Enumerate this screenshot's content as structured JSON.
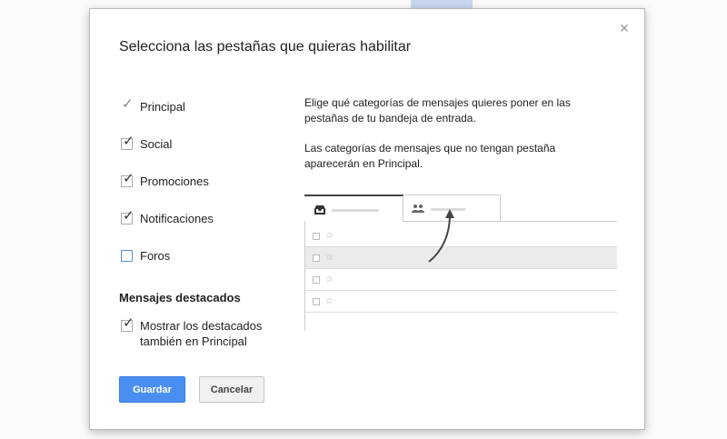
{
  "dialog": {
    "title": "Selecciona las pestañas que quieras habilitar",
    "close_icon": "close-icon"
  },
  "categories": [
    {
      "label": "Principal",
      "checked": true,
      "locked": true
    },
    {
      "label": "Social",
      "checked": true,
      "locked": false
    },
    {
      "label": "Promociones",
      "checked": true,
      "locked": false
    },
    {
      "label": "Notificaciones",
      "checked": true,
      "locked": false
    },
    {
      "label": "Foros",
      "checked": false,
      "locked": false
    }
  ],
  "starred": {
    "section_title": "Mensajes destacados",
    "option_label": "Mostrar los destacados también en Principal",
    "checked": true
  },
  "description": {
    "paragraph1": "Elige qué categorías de mensajes quieres poner en las pestañas de tu bandeja de entrada.",
    "paragraph2": "Las categorías de mensajes que no tengan pestaña aparecerán en Principal."
  },
  "preview": {
    "tab1_icon": "inbox-icon",
    "tab2_icon": "people-icon",
    "rows": 4
  },
  "buttons": {
    "save_label": "Guardar",
    "cancel_label": "Cancelar"
  },
  "colors": {
    "accent": "#4a8ef2",
    "cancel_bg": "#f1f1f1"
  }
}
